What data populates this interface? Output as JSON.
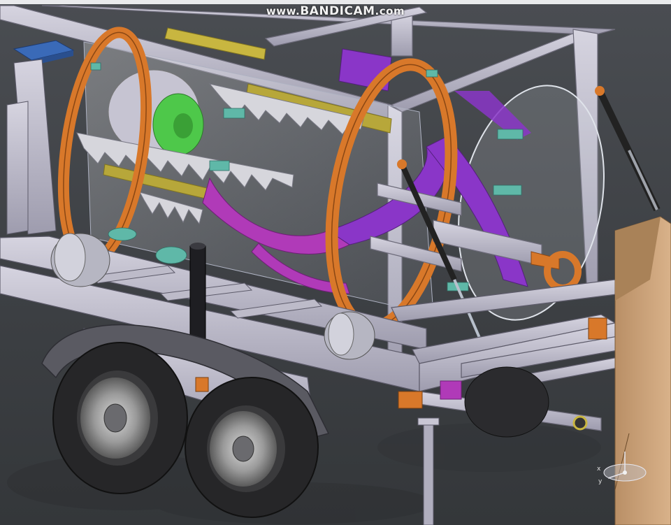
{
  "watermark": {
    "prefix": "www.",
    "brand": "BANDICAM",
    "suffix": ".com"
  },
  "compass": {
    "x_label": "x",
    "y_label": "y"
  },
  "colors": {
    "frame": "#c8c6d4",
    "orange_ring": "#d8782a",
    "purple_auger": "#8a36c8",
    "magenta": "#b03ab8",
    "teal": "#5fb8a8",
    "tire": "#2a2a2a",
    "cardboard": "#c9a27a"
  }
}
